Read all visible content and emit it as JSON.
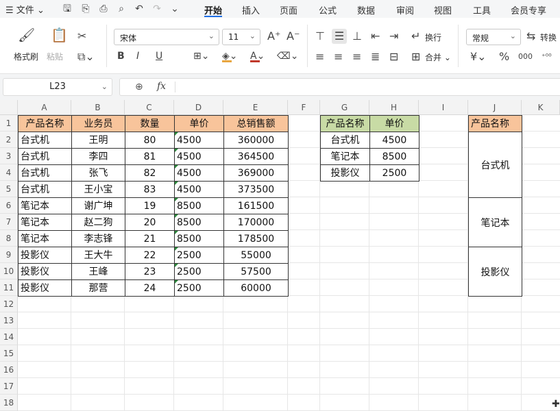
{
  "menubar": {
    "file_label": "文件",
    "tabs": [
      "开始",
      "插入",
      "页面",
      "公式",
      "数据",
      "审阅",
      "视图",
      "工具",
      "会员专享"
    ],
    "active_tab": "开始"
  },
  "ribbon": {
    "format_painter": "格式刷",
    "paste": "粘贴",
    "font_name": "宋体",
    "font_size": "11",
    "wrap": "换行",
    "merge": "合并",
    "number_format": "常规",
    "convert": "转换"
  },
  "formula_bar": {
    "name_box": "L23",
    "fx_label": "fx",
    "formula": ""
  },
  "grid": {
    "columns": [
      "A",
      "B",
      "C",
      "D",
      "E",
      "F",
      "G",
      "H",
      "I",
      "J",
      "K"
    ],
    "rows": [
      "1",
      "2",
      "3",
      "4",
      "5",
      "6",
      "7",
      "8",
      "9",
      "10",
      "11",
      "12",
      "13",
      "14",
      "15",
      "16",
      "17",
      "18"
    ]
  },
  "table1": {
    "headers": [
      "产品名称",
      "业务员",
      "数量",
      "单价",
      "总销售额"
    ],
    "rows": [
      [
        "台式机",
        "王明",
        "80",
        "4500",
        "360000"
      ],
      [
        "台式机",
        "李四",
        "81",
        "4500",
        "364500"
      ],
      [
        "台式机",
        "张飞",
        "82",
        "4500",
        "369000"
      ],
      [
        "台式机",
        "王小宝",
        "83",
        "4500",
        "373500"
      ],
      [
        "笔记本",
        "谢广坤",
        "19",
        "8500",
        "161500"
      ],
      [
        "笔记本",
        "赵二狗",
        "20",
        "8500",
        "170000"
      ],
      [
        "笔记本",
        "李志锋",
        "21",
        "8500",
        "178500"
      ],
      [
        "投影仪",
        "王大牛",
        "22",
        "2500",
        "55000"
      ],
      [
        "投影仪",
        "王峰",
        "23",
        "2500",
        "57500"
      ],
      [
        "投影仪",
        "那营",
        "24",
        "2500",
        "60000"
      ]
    ]
  },
  "table2": {
    "headers": [
      "产品名称",
      "单价"
    ],
    "rows": [
      [
        "台式机",
        "4500"
      ],
      [
        "笔记本",
        "8500"
      ],
      [
        "投影仪",
        "2500"
      ]
    ]
  },
  "table3": {
    "header": "产品名称",
    "groups": [
      "台式机",
      "笔记本",
      "投影仪"
    ]
  },
  "colors": {
    "orange_header": "#f8c49b",
    "green_header": "#c8dba5",
    "accent": "#1f6fe5"
  }
}
